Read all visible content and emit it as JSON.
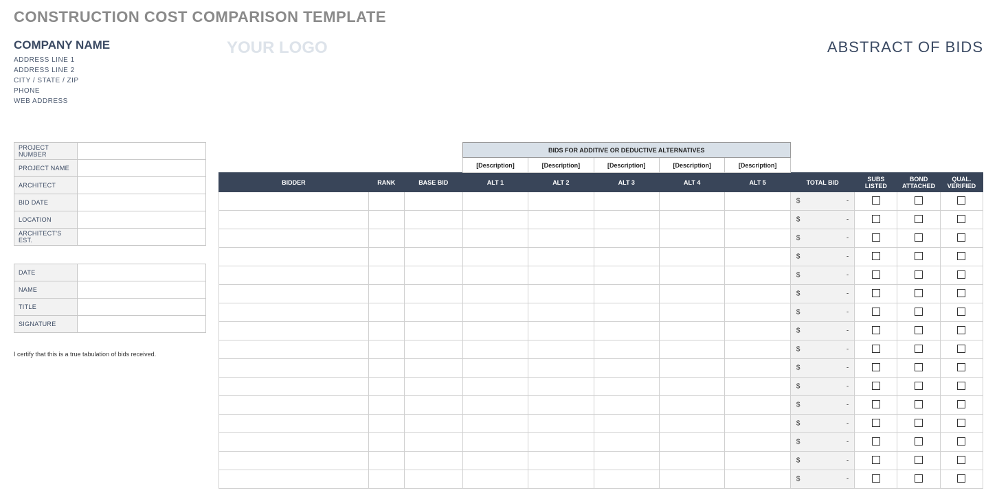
{
  "title": "CONSTRUCTION COST COMPARISON TEMPLATE",
  "company": {
    "name": "COMPANY NAME",
    "addr1": "ADDRESS LINE 1",
    "addr2": "ADDRESS LINE 2",
    "csz": "CITY / STATE / ZIP",
    "phone": "PHONE",
    "web": "WEB ADDRESS"
  },
  "logo_placeholder": "YOUR LOGO",
  "abstract_label": "ABSTRACT OF BIDS",
  "project_fields": [
    "PROJECT NUMBER",
    "PROJECT NAME",
    "ARCHITECT",
    "BID DATE",
    "LOCATION",
    "ARCHITECT'S EST."
  ],
  "sign_fields": [
    "DATE",
    "NAME",
    "TITLE",
    "SIGNATURE"
  ],
  "cert_note": "I certify that this is a true tabulation of bids received.",
  "bids": {
    "super_header": "BIDS FOR ADDITIVE OR DEDUCTIVE ALTERNATIVES",
    "alt_desc": [
      "[Description]",
      "[Description]",
      "[Description]",
      "[Description]",
      "[Description]"
    ],
    "columns": {
      "bidder": "BIDDER",
      "rank": "RANK",
      "base": "BASE BID",
      "alts": [
        "ALT 1",
        "ALT 2",
        "ALT 3",
        "ALT 4",
        "ALT 5"
      ],
      "total": "TOTAL BID",
      "subs": "SUBS LISTED",
      "bond": "BOND ATTACHED",
      "qual": "QUAL. VERIFIED"
    },
    "total_currency": "$",
    "total_value": "-",
    "row_count": 16
  }
}
